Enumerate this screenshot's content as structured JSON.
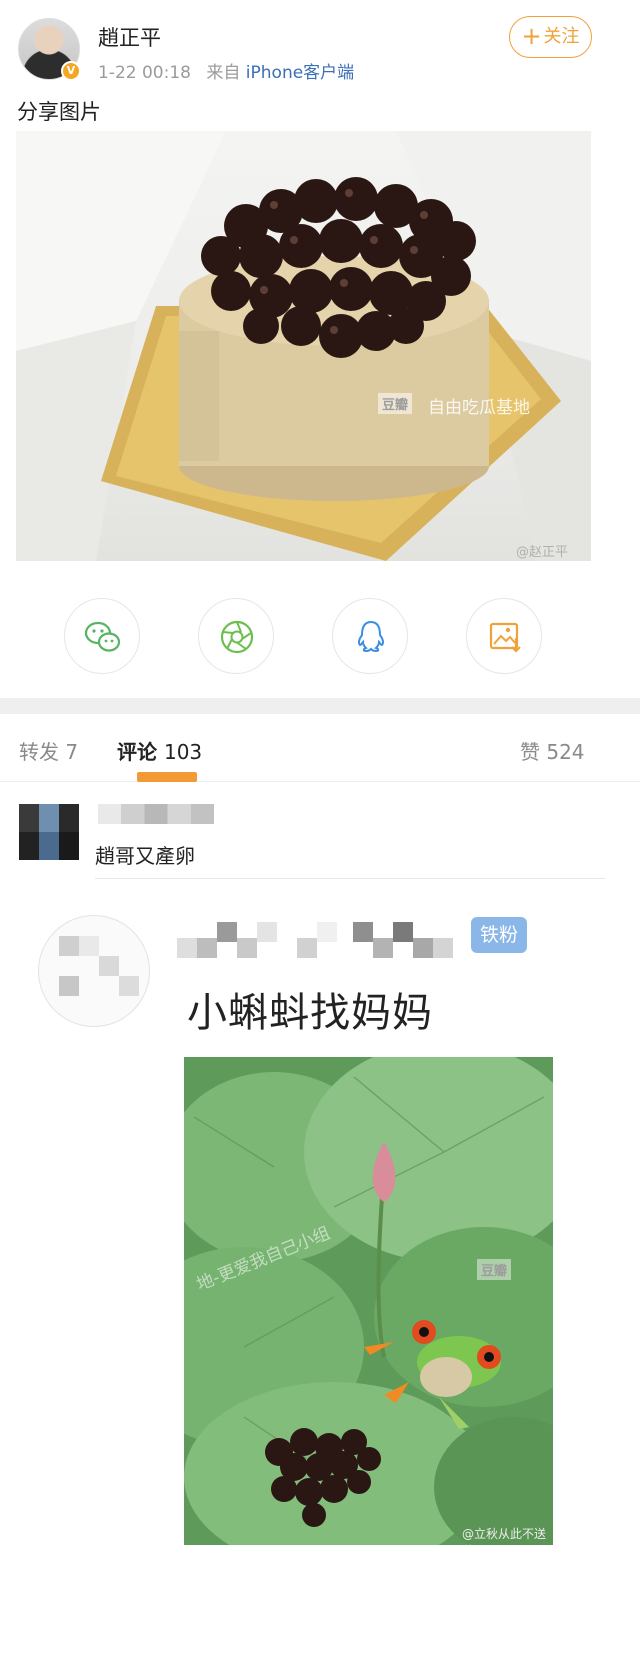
{
  "post": {
    "user_name": "趙正平",
    "verified_badge": "V",
    "timestamp": "1-22 00:18",
    "source_prefix": "来自",
    "source_link": "iPhone客户端",
    "follow_label": "关注",
    "text": "分享图片",
    "image_watermark_brand": "豆瓣",
    "image_watermark_group": "自由吃瓜基地",
    "image_watermark_weibo": "@赵正平"
  },
  "share": {
    "icons": [
      "wechat-icon",
      "moments-icon",
      "qq-icon",
      "save-image-icon"
    ],
    "colors": {
      "wechat": "#56b462",
      "moments": "#6cbf4e",
      "qq": "#3b8fe0",
      "save": "#f0a23a"
    }
  },
  "tabs": [
    {
      "label": "转发",
      "count": "7"
    },
    {
      "label": "评论",
      "count": "103"
    },
    {
      "label": "赞",
      "count": "524"
    }
  ],
  "comments": [
    {
      "text": "趙哥又產卵"
    }
  ],
  "meme": {
    "fan_badge": "铁粉",
    "caption": "小蝌蚪找妈妈",
    "watermark_brand": "豆瓣",
    "watermark_text": "地-更爱我自己小组",
    "watermark_weibo": "@立秋从此不送范"
  },
  "colors": {
    "accent": "#f39a36",
    "link": "#3b6fb6",
    "muted": "#9b9b9b"
  }
}
